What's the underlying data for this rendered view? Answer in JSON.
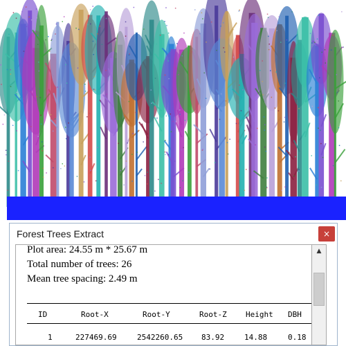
{
  "window": {
    "title": "Forest Trees Extract",
    "close_label": "×"
  },
  "summary": {
    "plot_area": "Plot area: 24.55 m * 25.67 m",
    "tree_count": "Total number of trees: 26",
    "mean_spacing": "Mean tree spacing: 2.49 m"
  },
  "table": {
    "headers": [
      "ID",
      "Root-X",
      "Root-Y",
      "Root-Z",
      "Height",
      "DBH"
    ],
    "rows": [
      [
        "1",
        "227469.69",
        "2542260.65",
        "83.92",
        "14.88",
        "0.18"
      ]
    ]
  },
  "scrollbar": {
    "up_arrow_icon": "scroll-up-arrow-icon"
  },
  "visualization": {
    "ground_color": "#1a22ff",
    "sky_color": "#ffffff",
    "tree_colors": [
      "#2e8a8a",
      "#3bbfa7",
      "#2a7fd6",
      "#7a4fd0",
      "#b03ab8",
      "#3aa03a",
      "#c04a6a",
      "#8f9fd8",
      "#4a3a9a",
      "#5a8ad6",
      "#c8a05a",
      "#d44a4a",
      "#22b0b0",
      "#6b2f7a",
      "#9a6bd8",
      "#3f7f3f",
      "#b8a0d8",
      "#c07030",
      "#1f5fb0",
      "#8b2040"
    ]
  }
}
